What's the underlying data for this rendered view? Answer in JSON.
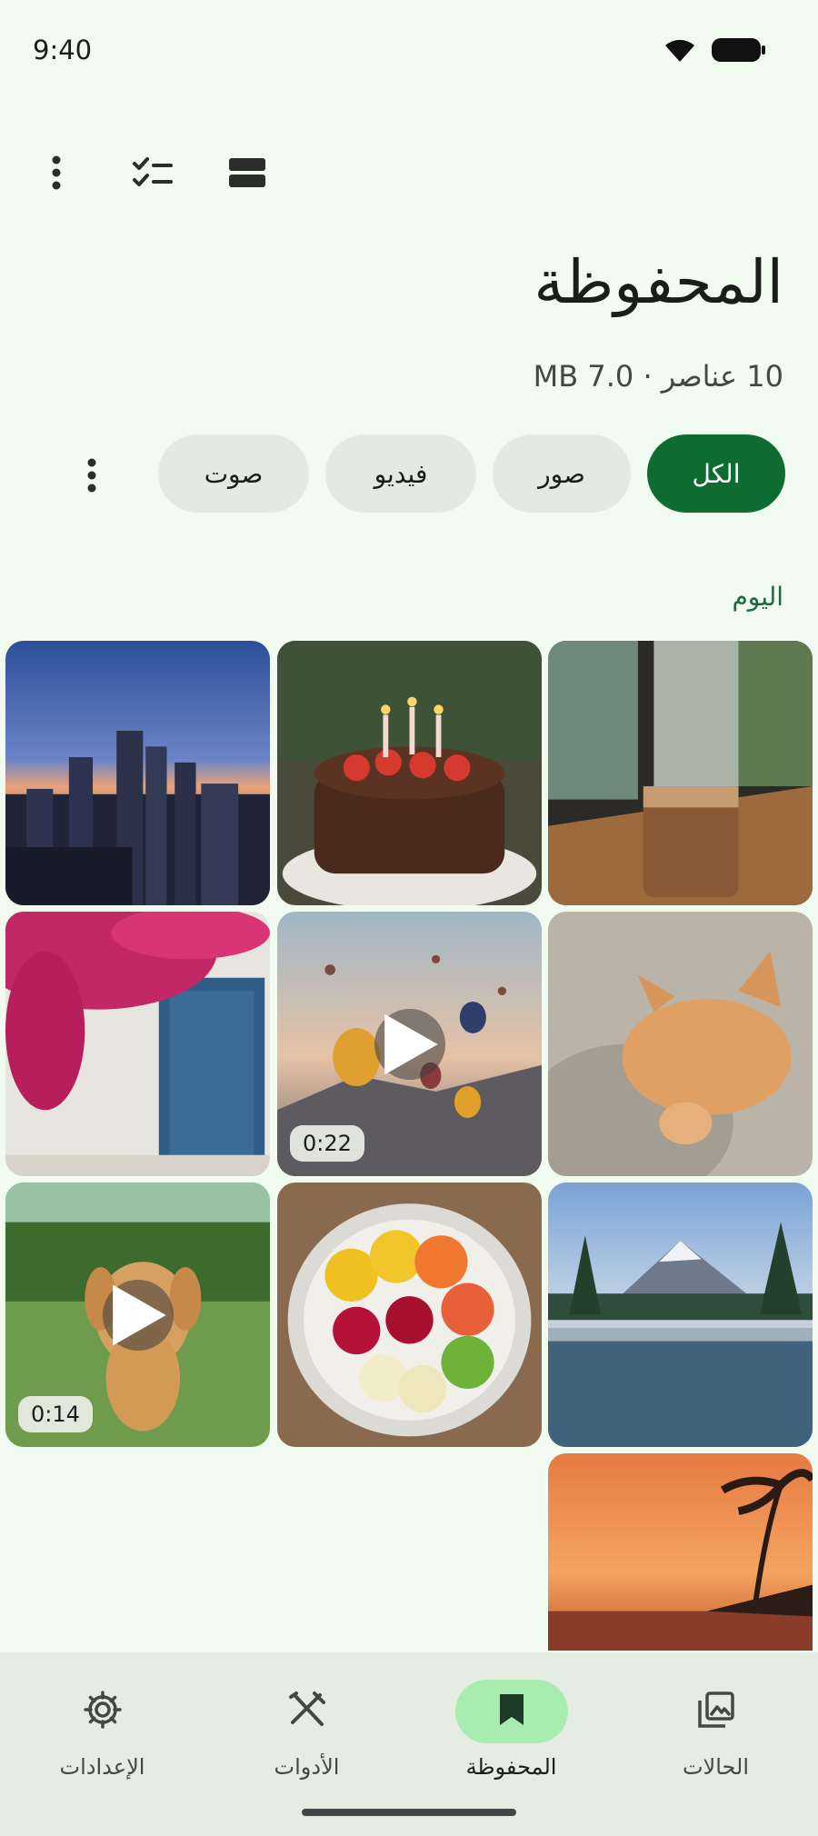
{
  "status_bar": {
    "time": "9:40"
  },
  "toolbar": {
    "icons": [
      "more-vert-icon",
      "checklist-icon",
      "view-list-icon"
    ]
  },
  "page": {
    "title": "المحفوظة",
    "subtitle": "10 عناصر · 7.0 MB"
  },
  "filters": {
    "chips": [
      {
        "label": "الكل",
        "active": true
      },
      {
        "label": "صور",
        "active": false
      },
      {
        "label": "فيديو",
        "active": false
      },
      {
        "label": "صوت",
        "active": false
      }
    ]
  },
  "section": {
    "label": "اليوم"
  },
  "media": [
    {
      "kind": "image",
      "subject": "city-skyline-dusk"
    },
    {
      "kind": "image",
      "subject": "birthday-cake"
    },
    {
      "kind": "image",
      "subject": "iced-coffee-window"
    },
    {
      "kind": "image",
      "subject": "bougainvillea-door"
    },
    {
      "kind": "video",
      "subject": "hot-air-balloons",
      "duration": "0:22"
    },
    {
      "kind": "image",
      "subject": "sleeping-kitten"
    },
    {
      "kind": "video",
      "subject": "puppy-running",
      "duration": "0:14"
    },
    {
      "kind": "image",
      "subject": "fruit-bowl"
    },
    {
      "kind": "image",
      "subject": "mountain-lake"
    },
    {
      "kind": "image",
      "subject": "tropical-sunset"
    }
  ],
  "bottom_nav": {
    "items": [
      {
        "label": "الحالات",
        "icon": "gallery-icon",
        "active": false
      },
      {
        "label": "المحفوظة",
        "icon": "bookmark-icon",
        "active": true
      },
      {
        "label": "الأدوات",
        "icon": "tools-icon",
        "active": false
      },
      {
        "label": "الإعدادات",
        "icon": "settings-icon",
        "active": false
      }
    ]
  },
  "colors": {
    "accent": "#0e6b32",
    "background": "#f1fbef",
    "nav_active": "#a9ecb0"
  }
}
